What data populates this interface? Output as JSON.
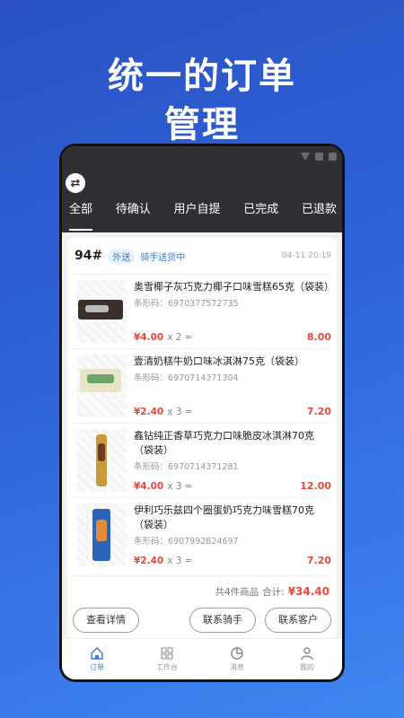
{
  "headline": {
    "line1": "统一的订单",
    "line2": "管理"
  },
  "topbar": {
    "swap_icon": "swap-icon"
  },
  "tabs": [
    {
      "label": "全部",
      "active": true
    },
    {
      "label": "待确认"
    },
    {
      "label": "用户自提"
    },
    {
      "label": "已完成"
    },
    {
      "label": "已退款"
    }
  ],
  "order": {
    "number": "94#",
    "type": "外送",
    "status": "骑手送货中",
    "time": "04-11 20:19",
    "items": [
      {
        "name": "奥雪椰子灰巧克力椰子口味雪糕65克（袋装）",
        "barcode": "条形码：6970377572735",
        "price": "¥4.00",
        "qty": "x 2 =",
        "subtotal": "8.00"
      },
      {
        "name": "壹清奶糕牛奶口味冰淇淋75克（袋装）",
        "barcode": "条形码：6970714371304",
        "price": "¥2.40",
        "qty": "x 3 =",
        "subtotal": "7.20"
      },
      {
        "name": "鑫钻纯正香草巧克力口味脆皮冰淇淋70克（袋装）",
        "barcode": "条形码：6970714371281",
        "price": "¥4.00",
        "qty": "x 3 =",
        "subtotal": "12.00"
      },
      {
        "name": "伊利巧乐兹四个圈蛋奶巧克力味雪糕70克（袋装）",
        "barcode": "条形码：6907992824697",
        "price": "¥2.40",
        "qty": "x 3 =",
        "subtotal": "7.20"
      }
    ],
    "summary_count": "共4件商品",
    "summary_label": "合计:",
    "summary_total": "¥34.40"
  },
  "actions": {
    "details": "查看详情",
    "contact_rider": "联系骑手",
    "contact_customer": "联系客户"
  },
  "nav": [
    {
      "label": "订单",
      "icon": "home-icon",
      "active": true
    },
    {
      "label": "工作台",
      "icon": "grid-icon"
    },
    {
      "label": "消息",
      "icon": "chart-icon"
    },
    {
      "label": "我的",
      "icon": "user-icon"
    }
  ],
  "colors": {
    "accent": "#3b7be0",
    "price": "#e8483b",
    "topbar": "#2f3036"
  }
}
